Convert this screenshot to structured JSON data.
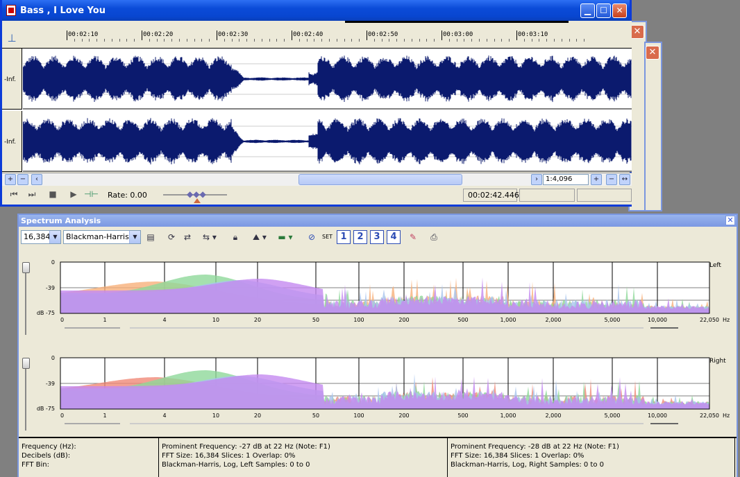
{
  "wave_window": {
    "title": "Bass , I Love You",
    "timeline_labels": [
      "00:02:10",
      "00:02:20",
      "00:02:30",
      "00:02:40",
      "00:02:50",
      "00:03:00",
      "00:03:10"
    ],
    "channel_labels": [
      "-Inf.",
      "-Inf."
    ],
    "zoom_ratio": "1:4,096",
    "rate_label": "Rate: 0.00",
    "position_time": "00:02:42.446",
    "waveform_color": "#0b1a6e"
  },
  "spectrum_window": {
    "title": "Spectrum Analysis",
    "fft_size": "16,384",
    "window_type": "Blackman-Harris",
    "set_label": "SET",
    "snapshot_buttons": [
      "1",
      "2",
      "3",
      "4"
    ],
    "db_labels": [
      "0",
      "-39",
      "dB -75"
    ],
    "freq_labels": [
      "0",
      "1",
      "4",
      "10",
      "20",
      "50",
      "100",
      "200",
      "500",
      "1,000",
      "2,000",
      "5,000",
      "10,000",
      "22,050"
    ],
    "hz_label": "Hz",
    "channels": [
      "Left",
      "Right"
    ],
    "status": {
      "labels": [
        "Frequency (Hz):",
        "Decibels (dB):",
        "FFT Bin:"
      ],
      "left": [
        "Prominent Frequency: -27 dB at 22 Hz (Note: F1)",
        "FFT Size: 16,384  Slices: 1  Overlap: 0%",
        "Blackman-Harris, Log, Left  Samples: 0 to 0"
      ],
      "right": [
        "Prominent Frequency: -28 dB at 22 Hz (Note: F1)",
        "FFT Size: 16,384  Slices: 1  Overlap: 0%",
        "Blackman-Harris, Log, Right  Samples: 0 to 0"
      ]
    }
  }
}
